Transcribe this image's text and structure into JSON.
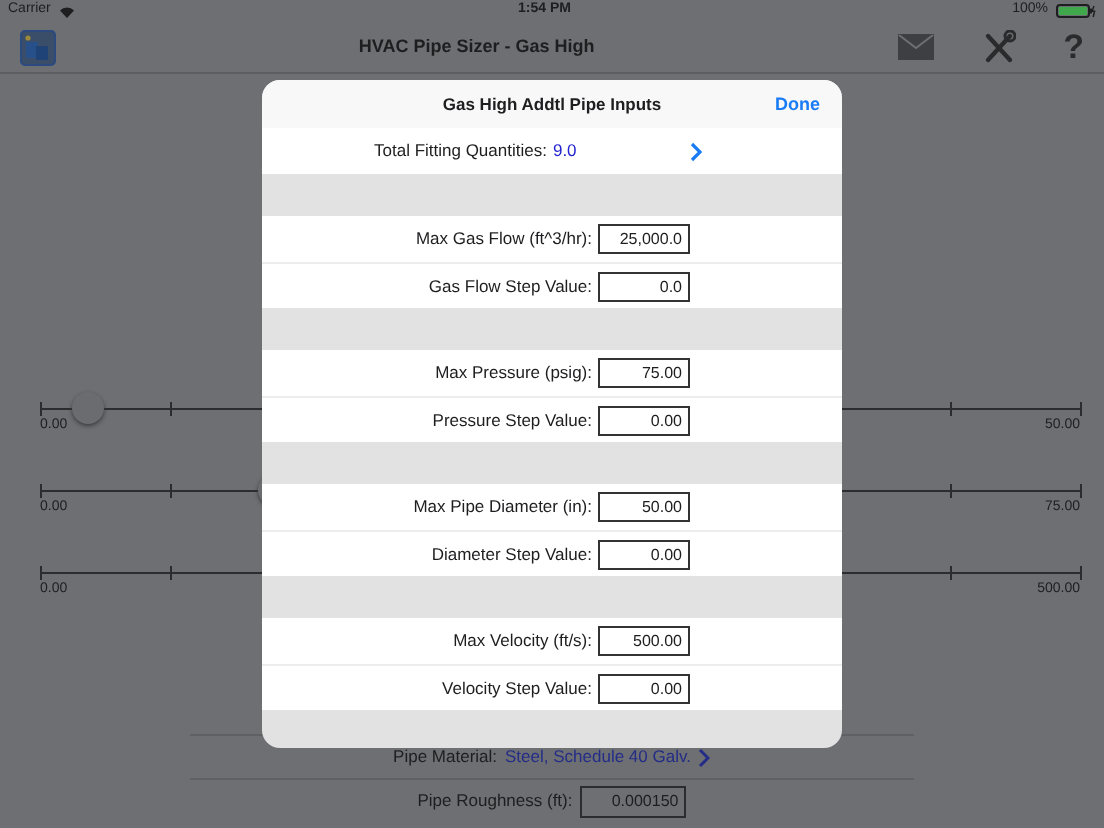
{
  "status_bar": {
    "carrier": "Carrier",
    "time": "1:54 PM",
    "battery": "100%"
  },
  "nav_bar": {
    "title": "HVAC Pipe Sizer - Gas High",
    "help": "?"
  },
  "sliders": [
    {
      "min": "0.00",
      "max": "50.00",
      "level": 0.03
    },
    {
      "min": "0.00",
      "max": "75.00",
      "level": 0.21
    },
    {
      "min": "0.00",
      "max": "500.00"
    }
  ],
  "pipe_material": {
    "label": "Pipe Material:",
    "value": "Steel, Schedule 40 Galv."
  },
  "pipe_roughness": {
    "label": "Pipe Roughness (ft):",
    "value": "0.000150"
  },
  "dialog": {
    "title": "Gas High Addtl Pipe Inputs",
    "done": "Done",
    "fitting": {
      "label": "Total Fitting Quantities:",
      "value": "9.0"
    },
    "groups": [
      [
        {
          "label": "Max Gas Flow (ft^3/hr):",
          "value": "25,000.0"
        },
        {
          "label": "Gas Flow Step Value:",
          "value": "0.0"
        }
      ],
      [
        {
          "label": "Max Pressure (psig):",
          "value": "75.00"
        },
        {
          "label": "Pressure Step Value:",
          "value": "0.00"
        }
      ],
      [
        {
          "label": "Max Pipe Diameter (in):",
          "value": "50.00"
        },
        {
          "label": "Diameter Step Value:",
          "value": "0.00"
        }
      ],
      [
        {
          "label": "Max Velocity (ft/s):",
          "value": "500.00"
        },
        {
          "label": "Velocity Step Value:",
          "value": "0.00"
        }
      ]
    ]
  }
}
